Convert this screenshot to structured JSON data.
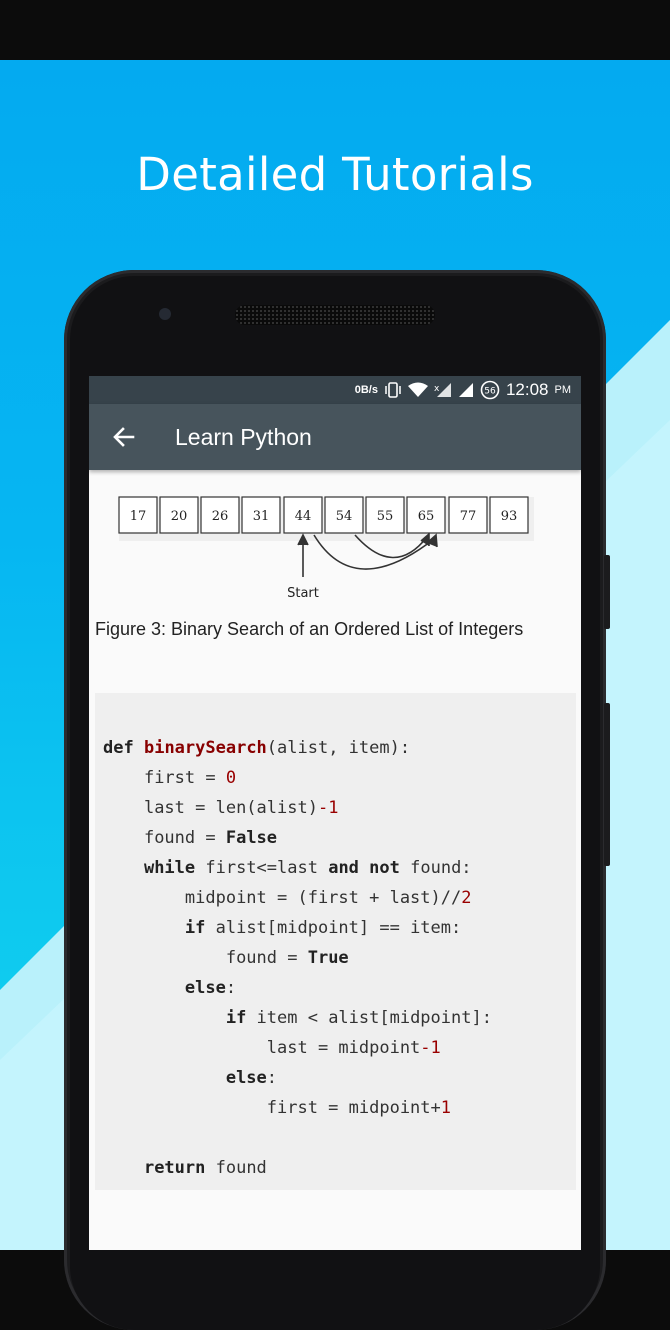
{
  "promo": {
    "title": "Detailed Tutorials"
  },
  "status_bar": {
    "speed": "0B/s",
    "battery": "56",
    "time": "12:08",
    "ampm": "PM"
  },
  "app_bar": {
    "title": "Learn Python"
  },
  "figure": {
    "numbers": [
      "17",
      "20",
      "26",
      "31",
      "44",
      "54",
      "55",
      "65",
      "77",
      "93"
    ],
    "start_label": "Start",
    "caption": "Figure 3: Binary Search of an Ordered List of Integers"
  },
  "code": {
    "kw_def": "def",
    "fn_name": "binarySearch",
    "sig_rest": "(alist, item):",
    "first_assign": "first = ",
    "num_0": "0",
    "last_assign": "last = len(alist)",
    "num_minus1a": "-1",
    "found_assign": "found = ",
    "kw_false": "False",
    "kw_while": "while",
    "while_mid": " first<=last ",
    "kw_and": "and",
    "kw_not": "not",
    "while_end": " found:",
    "midpoint_assign": "midpoint = (first + last)//",
    "num_2": "2",
    "kw_if": "if",
    "if_cond": " alist[midpoint] == item:",
    "found_true": "found = ",
    "kw_true": "True",
    "kw_else": "else",
    "colon": ":",
    "kw_if2": "if",
    "if2_cond": " item < alist[midpoint]:",
    "last_mid": "last = midpoint",
    "num_minus1b": "-1",
    "kw_else2": "else",
    "colon2": ":",
    "first_mid": "first = midpoint+",
    "num_1": "1",
    "kw_return": "return",
    "return_rest": " found"
  },
  "colors": {
    "promo_blue": "#04aaf0",
    "appbar": "#47545c",
    "statusbar": "#37434b",
    "code_bg": "#efefef",
    "fn_red": "#880000"
  }
}
